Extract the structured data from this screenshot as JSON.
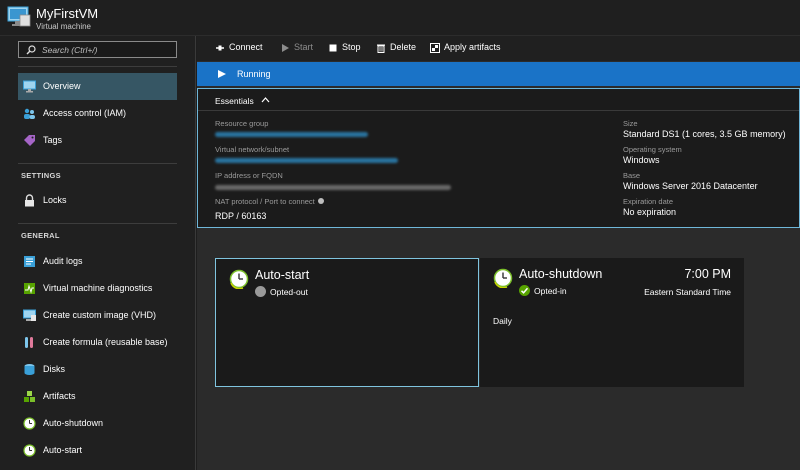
{
  "header": {
    "title": "MyFirstVM",
    "subtitle": "Virtual machine"
  },
  "sidebar": {
    "search_placeholder": "Search (Ctrl+/)",
    "items_top": [
      {
        "label": "Overview",
        "icon": "monitor-icon"
      },
      {
        "label": "Access control (IAM)",
        "icon": "users-icon"
      },
      {
        "label": "Tags",
        "icon": "tag-icon"
      }
    ],
    "settings_heading": "SETTINGS",
    "settings_items": [
      {
        "label": "Locks",
        "icon": "lock-icon"
      }
    ],
    "general_heading": "GENERAL",
    "general_items": [
      {
        "label": "Audit logs",
        "icon": "log-icon"
      },
      {
        "label": "Virtual machine diagnostics",
        "icon": "diagnostics-icon"
      },
      {
        "label": "Create custom image (VHD)",
        "icon": "image-icon"
      },
      {
        "label": "Create formula (reusable base)",
        "icon": "formula-icon"
      },
      {
        "label": "Disks",
        "icon": "disk-icon"
      },
      {
        "label": "Artifacts",
        "icon": "artifacts-icon"
      },
      {
        "label": "Auto-shutdown",
        "icon": "clock-icon"
      },
      {
        "label": "Auto-start",
        "icon": "clock-icon"
      }
    ]
  },
  "toolbar": {
    "connect": "Connect",
    "start": "Start",
    "stop": "Stop",
    "delete": "Delete",
    "apply_artifacts": "Apply artifacts"
  },
  "status": {
    "label": "Running",
    "color": "#1a73c7"
  },
  "essentials": {
    "heading": "Essentials",
    "left": [
      {
        "label": "Resource group"
      },
      {
        "label": "Virtual network/subnet"
      },
      {
        "label": "IP address or FQDN"
      },
      {
        "label": "NAT protocol / Port to connect",
        "value": "RDP / 60163"
      }
    ],
    "right": [
      {
        "label": "Size",
        "value": "Standard DS1 (1 cores, 3.5 GB memory)"
      },
      {
        "label": "Operating system",
        "value": "Windows"
      },
      {
        "label": "Base",
        "value": "Windows Server 2016 Datacenter"
      },
      {
        "label": "Expiration date",
        "value": "No expiration"
      }
    ]
  },
  "cards": {
    "autostart": {
      "title": "Auto-start",
      "status": "Opted-out"
    },
    "autoshutdown": {
      "title": "Auto-shutdown",
      "status": "Opted-in",
      "time": "7:00 PM",
      "timezone": "Eastern Standard Time",
      "recurrence": "Daily"
    }
  },
  "colors": {
    "accent": "#1a73c7",
    "active_nav": "#365664",
    "card_border": "#7fc4df",
    "opted_in": "#57a300"
  }
}
